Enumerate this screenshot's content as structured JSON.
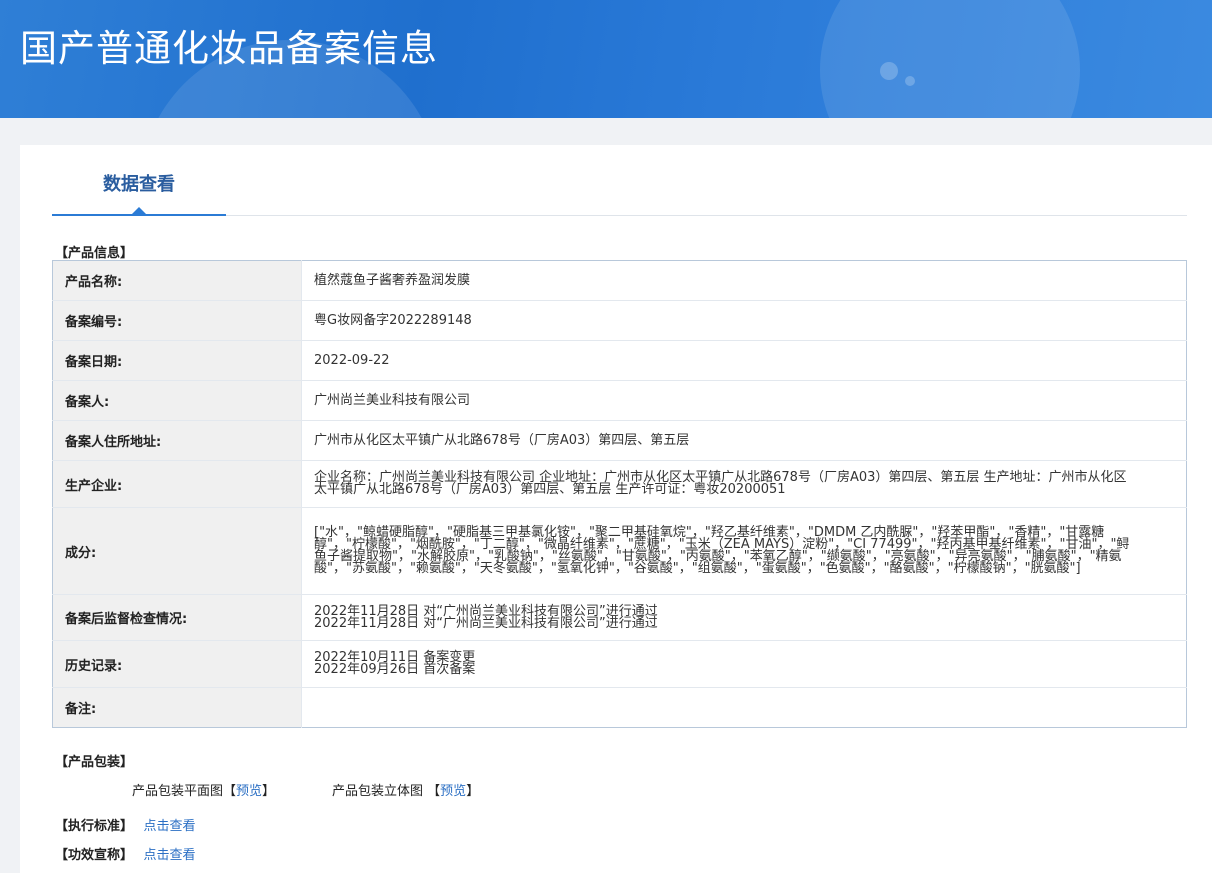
{
  "header": {
    "title": "国产普通化妆品备案信息"
  },
  "tabs": [
    {
      "label": "数据查看"
    }
  ],
  "product_info": {
    "section_title": "【产品信息】",
    "rows": [
      {
        "label": "产品名称:",
        "value": "植然蔻鱼子酱奢养盈润发膜"
      },
      {
        "label": "备案编号:",
        "value": "粤G妆网备字2022289148"
      },
      {
        "label": "备案日期:",
        "value": "2022-09-22"
      },
      {
        "label": "备案人:",
        "value": "广州尚兰美业科技有限公司"
      },
      {
        "label": "备案人住所地址:",
        "value": "广州市从化区太平镇广从北路678号（厂房A03）第四层、第五层"
      },
      {
        "label": "生产企业:",
        "value": "企业名称：广州尚兰美业科技有限公司 企业地址：广州市从化区太平镇广从北路678号（厂房A03）第四层、第五层 生产地址：广州市从化区太平镇广从北路678号（厂房A03）第四层、第五层 生产许可证：粤妆20200051"
      },
      {
        "label": "成分:",
        "value": "[\"水\"，\"鲸蜡硬脂醇\"，\"硬脂基三甲基氯化铵\"，\"聚二甲基硅氧烷\"，\"羟乙基纤维素\"，\"DMDM 乙内酰脲\"，\"羟苯甲酯\"，\"香精\"，\"甘露糖醇\"，\"柠檬酸\"，\"烟酰胺\"，\"丁二醇\"，\"微晶纤维素\"，\"蔗糖\"，\"玉米（ZEA MAYS）淀粉\"，\"CI 77499\"，\"羟丙基甲基纤维素\"，\"甘油\"，\"鲟鱼子酱提取物\"，\"水解胶原\"，\"乳酸钠\"，\"丝氨酸\"，\"甘氨酸\"，\"丙氨酸\"，\"苯氧乙醇\"，\"缬氨酸\"，\"亮氨酸\"，\"异亮氨酸\"，\"脯氨酸\"，\"精氨酸\"，\"苏氨酸\"，\"赖氨酸\"，\"天冬氨酸\"，\"氢氧化钾\"，\"谷氨酸\"，\"组氨酸\"，\"蛋氨酸\"，\"色氨酸\"，\"酪氨酸\"，\"柠檬酸钠\"，\"胱氨酸\"]"
      },
      {
        "label": "备案后监督检查情况:",
        "lines": [
          "2022年11月28日 对“广州尚兰美业科技有限公司”进行通过",
          "2022年11月28日 对“广州尚兰美业科技有限公司”进行通过"
        ]
      },
      {
        "label": "历史记录:",
        "lines": [
          "2022年10月11日 备案变更",
          "2022年09月26日 首次备案"
        ]
      },
      {
        "label": "备注:",
        "value": ""
      }
    ]
  },
  "packaging": {
    "section_title": "【产品包装】",
    "flat": {
      "label": "产品包装平面图",
      "bracket_open": "【",
      "link": "预览",
      "bracket_close": "】"
    },
    "solid": {
      "label": "产品包装立体图",
      "bracket_open": "【",
      "link": "预览",
      "bracket_close": "】"
    }
  },
  "standard": {
    "section_title": "【执行标准】",
    "link": "点击查看"
  },
  "efficacy": {
    "section_title": "【功效宣称】",
    "link": "点击查看"
  }
}
